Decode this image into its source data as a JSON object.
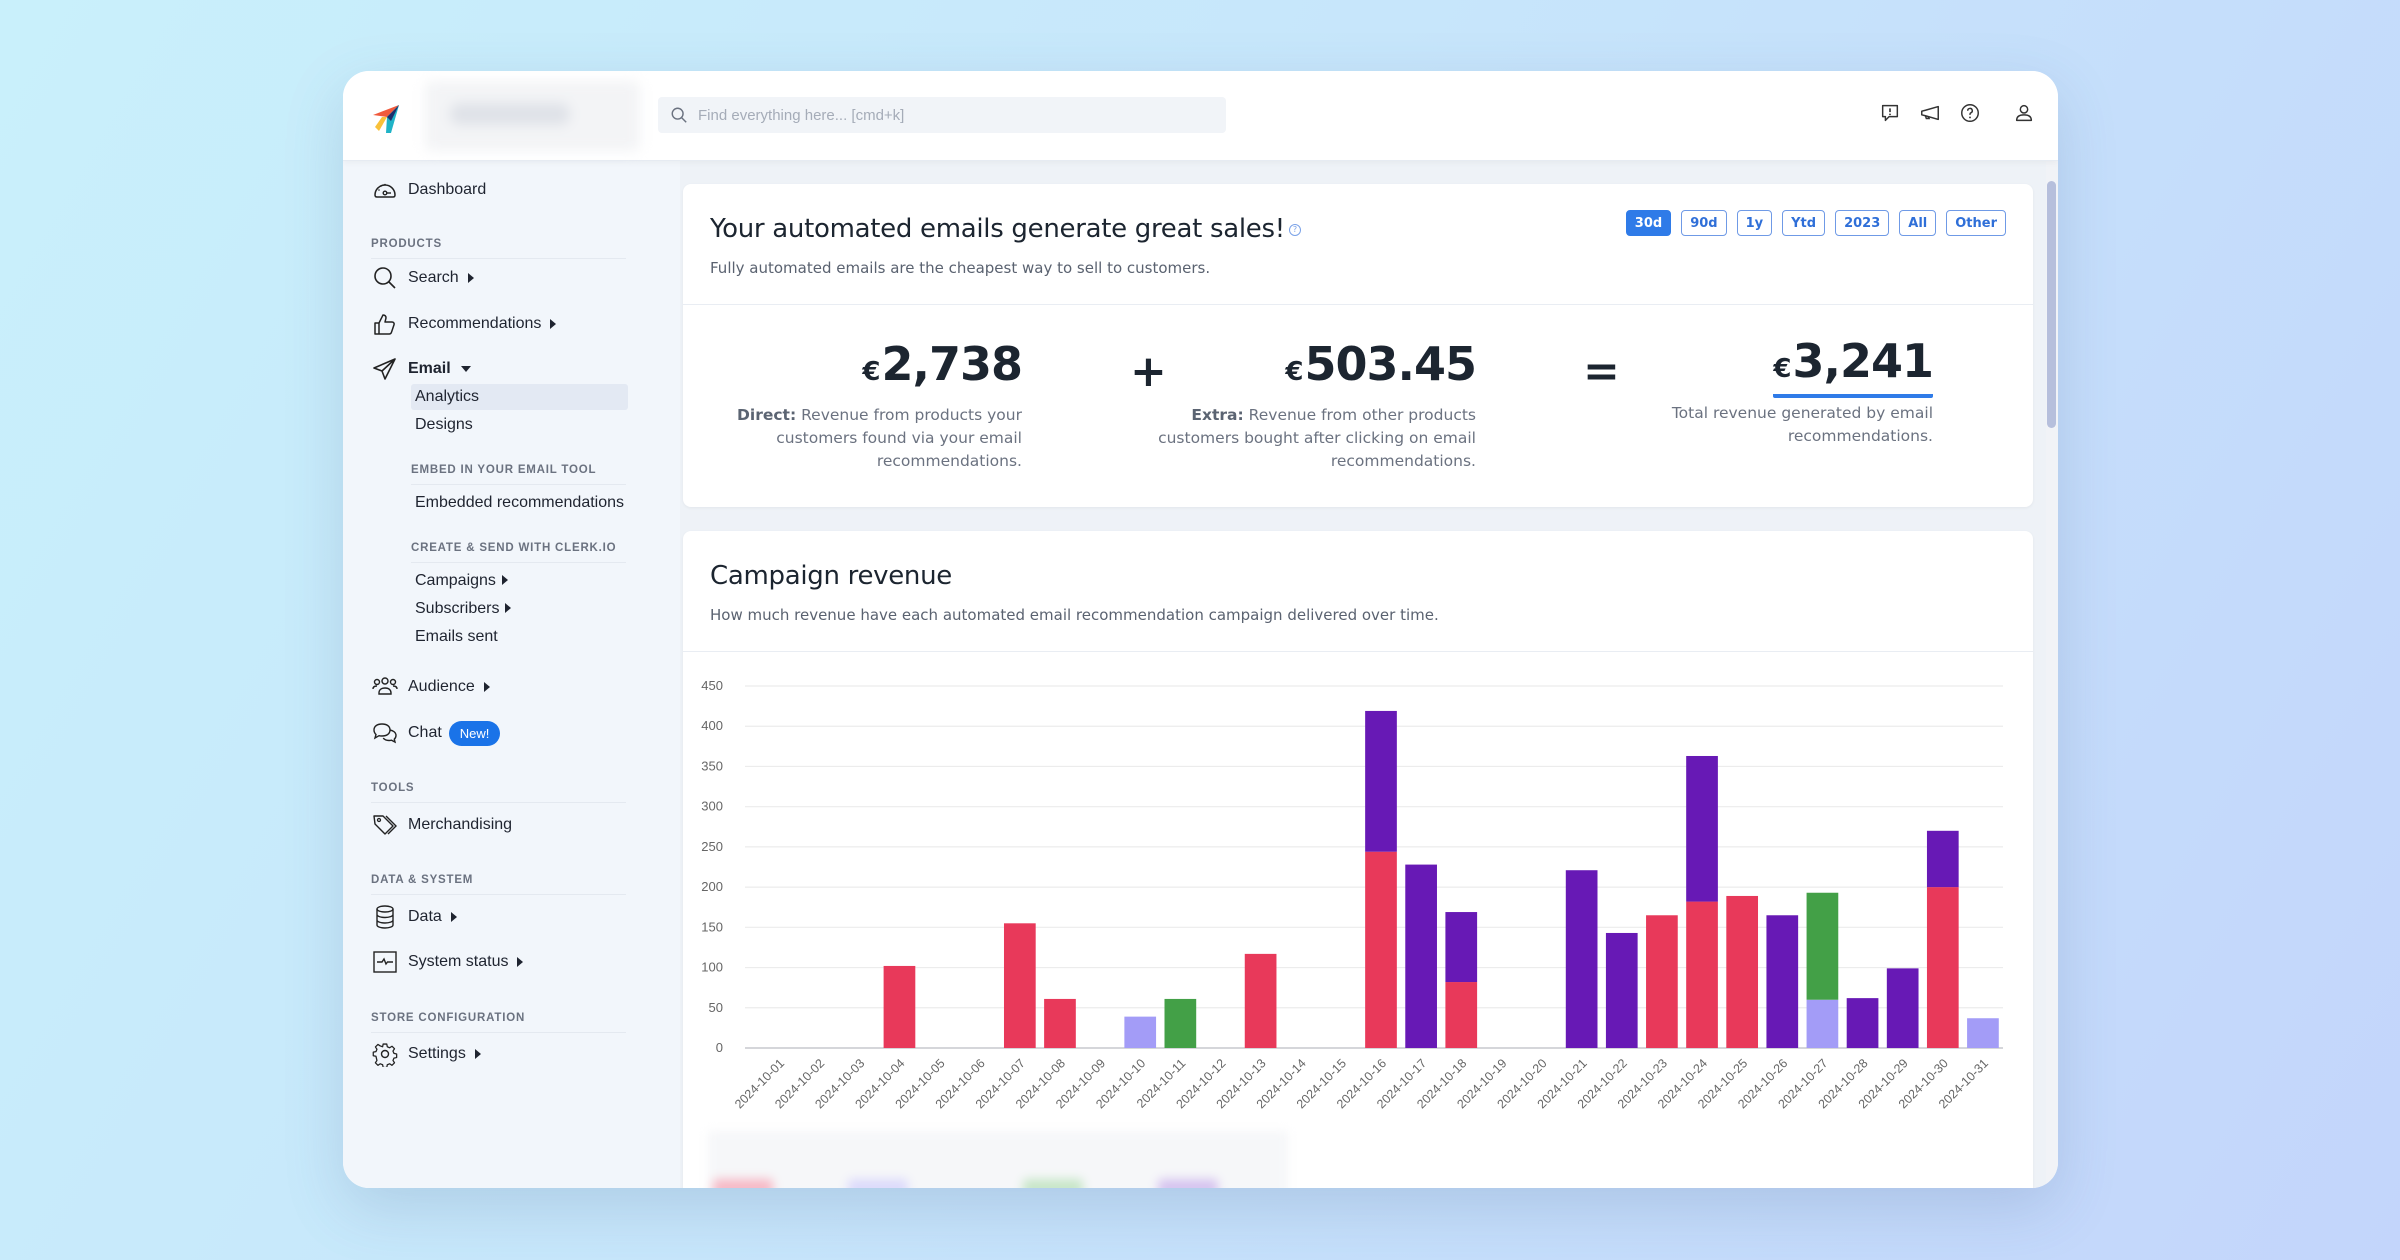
{
  "header": {
    "search_placeholder": "Find everything here... [cmd+k]",
    "icons": [
      "feedback-icon",
      "announcements-icon",
      "help-icon",
      "user-icon"
    ]
  },
  "sidebar": {
    "dashboard": "Dashboard",
    "sections": {
      "products": "PRODUCTS",
      "tools": "TOOLS",
      "data_system": "DATA & SYSTEM",
      "store_config": "STORE CONFIGURATION"
    },
    "items": {
      "search": "Search",
      "recommendations": "Recommendations",
      "email": "Email",
      "audience": "Audience",
      "chat": "Chat",
      "chat_badge": "New!",
      "merchandising": "Merchandising",
      "data": "Data",
      "system_status": "System status",
      "settings": "Settings"
    },
    "email_sub": {
      "analytics": "Analytics",
      "designs": "Designs",
      "embed_head": "EMBED IN YOUR EMAIL TOOL",
      "embedded": "Embedded recommendations",
      "create_head": "CREATE & SEND WITH CLERK.IO",
      "campaigns": "Campaigns",
      "subscribers": "Subscribers",
      "emails_sent": "Emails sent"
    }
  },
  "summary": {
    "title": "Your automated emails generate great sales!",
    "help": "?",
    "subtitle": "Fully automated emails are the cheapest way to sell to customers.",
    "periods": [
      "30d",
      "90d",
      "1y",
      "Ytd",
      "2023",
      "All",
      "Other"
    ],
    "active_period": "30d",
    "currency": "€",
    "direct": {
      "value": "2,738",
      "label": "Direct:",
      "desc": "Revenue from products your customers found via your email recommendations."
    },
    "plus": "+",
    "extra": {
      "value": "503.45",
      "label": "Extra:",
      "desc": "Revenue from other products customers bought after clicking on email recommendations."
    },
    "equals": "=",
    "total": {
      "value": "3,241",
      "desc": "Total revenue generated by email recommendations."
    }
  },
  "campaign": {
    "title": "Campaign revenue",
    "subtitle": "How much revenue have each automated email recommendation campaign delivered over time."
  },
  "colors": {
    "accent": "#2f7be8",
    "series_red": "#e8395a",
    "series_purple": "#6719b5",
    "series_green": "#43a047",
    "series_lavender": "#a39cf7"
  },
  "chart_data": {
    "type": "bar",
    "stacked": true,
    "title": "Campaign revenue",
    "xlabel": "",
    "ylabel": "",
    "ylim": [
      0,
      450
    ],
    "yticks": [
      0,
      50,
      100,
      150,
      200,
      250,
      300,
      350,
      400,
      450
    ],
    "grid": true,
    "legend": "bottom (blurred)",
    "categories": [
      "2024-10-01",
      "2024-10-02",
      "2024-10-03",
      "2024-10-04",
      "2024-10-05",
      "2024-10-06",
      "2024-10-07",
      "2024-10-08",
      "2024-10-09",
      "2024-10-10",
      "2024-10-11",
      "2024-10-12",
      "2024-10-13",
      "2024-10-14",
      "2024-10-15",
      "2024-10-16",
      "2024-10-17",
      "2024-10-18",
      "2024-10-19",
      "2024-10-20",
      "2024-10-21",
      "2024-10-22",
      "2024-10-23",
      "2024-10-24",
      "2024-10-25",
      "2024-10-26",
      "2024-10-27",
      "2024-10-28",
      "2024-10-29",
      "2024-10-30",
      "2024-10-31"
    ],
    "series": [
      {
        "name": "red",
        "color": "#e8395a",
        "values": [
          0,
          0,
          0,
          102,
          0,
          0,
          155,
          61,
          0,
          0,
          0,
          0,
          117,
          0,
          0,
          244,
          0,
          82,
          0,
          0,
          0,
          0,
          165,
          182,
          189,
          0,
          0,
          0,
          0,
          200,
          0
        ]
      },
      {
        "name": "lavender",
        "color": "#a39cf7",
        "values": [
          0,
          0,
          0,
          0,
          0,
          0,
          0,
          0,
          0,
          39,
          0,
          0,
          0,
          0,
          0,
          0,
          0,
          0,
          0,
          0,
          0,
          0,
          0,
          0,
          0,
          0,
          60,
          0,
          0,
          0,
          37
        ]
      },
      {
        "name": "green",
        "color": "#43a047",
        "values": [
          0,
          0,
          0,
          0,
          0,
          0,
          0,
          0,
          0,
          0,
          61,
          0,
          0,
          0,
          0,
          0,
          0,
          0,
          0,
          0,
          0,
          0,
          0,
          0,
          0,
          0,
          133,
          0,
          0,
          0,
          0
        ]
      },
      {
        "name": "purple",
        "color": "#6719b5",
        "values": [
          0,
          0,
          0,
          0,
          0,
          0,
          0,
          0,
          0,
          0,
          0,
          0,
          0,
          0,
          0,
          175,
          228,
          87,
          0,
          0,
          221,
          143,
          0,
          181,
          0,
          165,
          0,
          62,
          99,
          70,
          0
        ]
      }
    ]
  }
}
